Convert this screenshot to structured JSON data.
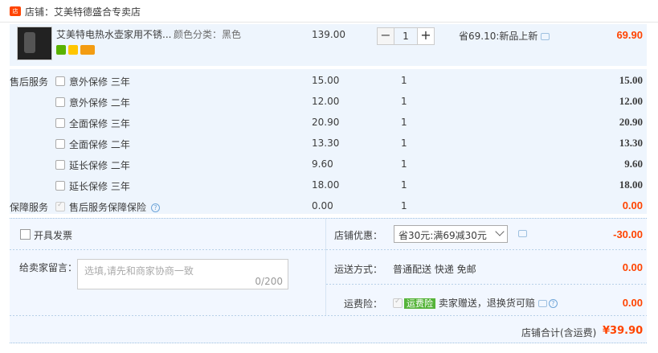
{
  "shop": {
    "label": "店铺：",
    "name": "艾美特德盛合专卖店"
  },
  "item": {
    "title": "艾美特电热水壶家用不锈...",
    "sku": "颜色分类：黑色",
    "price": "139.00",
    "quantity": "1",
    "discount_text": "省69.10:新品上新",
    "subtotal": "69.90"
  },
  "after_sales": {
    "label": "售后服务",
    "options": [
      {
        "name": "意外保修 三年",
        "price": "15.00",
        "qty": "1",
        "subtotal": "15.00"
      },
      {
        "name": "意外保修 二年",
        "price": "12.00",
        "qty": "1",
        "subtotal": "12.00"
      },
      {
        "name": "全面保修 三年",
        "price": "20.90",
        "qty": "1",
        "subtotal": "20.90"
      },
      {
        "name": "全面保修 二年",
        "price": "13.30",
        "qty": "1",
        "subtotal": "13.30"
      },
      {
        "name": "延长保修 二年",
        "price": "9.60",
        "qty": "1",
        "subtotal": "9.60"
      },
      {
        "name": "延长保修 三年",
        "price": "18.00",
        "qty": "1",
        "subtotal": "18.00"
      }
    ]
  },
  "guarantee": {
    "label": "保障服务",
    "name": "售后服务保障保险",
    "price": "0.00",
    "qty": "1",
    "subtotal": "0.00"
  },
  "invoice": {
    "label": "开具发票"
  },
  "message": {
    "label": "给卖家留言：",
    "placeholder": "选填,请先和商家协商一致",
    "count": "0/200"
  },
  "shop_discount": {
    "label": "店铺优惠：",
    "selected": "省30元:满69减30元",
    "amount": "-30.00"
  },
  "shipping": {
    "label": "运送方式：",
    "text": "普通配送 快递 免邮",
    "amount": "0.00"
  },
  "freight_insurance": {
    "label": "运费险：",
    "badge": "运费险",
    "text": "卖家赠送，退换货可赔",
    "amount": "0.00"
  },
  "total": {
    "label": "店铺合计(含运费)",
    "value": "¥39.90"
  },
  "colors": {
    "accent": "#ff4400",
    "row_bg": "#eef5fd",
    "footer_bg": "#f2f7ff",
    "insurance_green": "#56b43a"
  }
}
